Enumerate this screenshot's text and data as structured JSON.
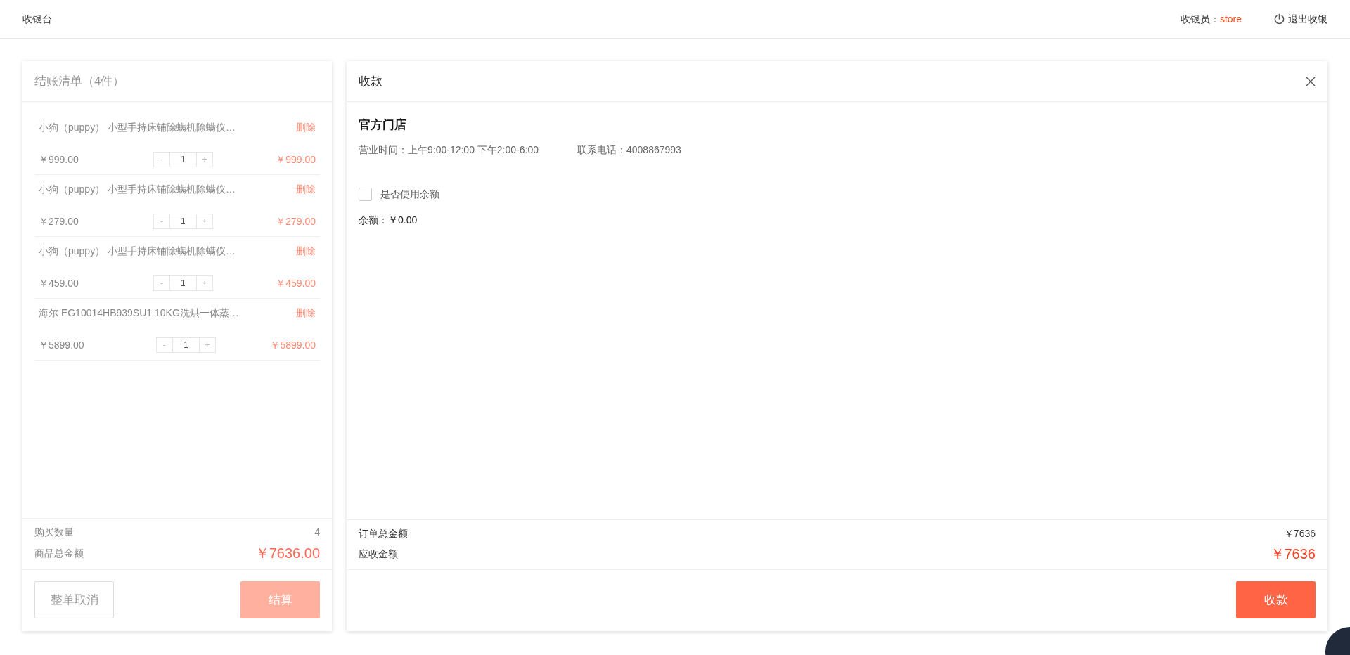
{
  "header": {
    "title": "收银台",
    "cashier_label": "收银员：",
    "cashier_name": "store",
    "logout": "退出收银"
  },
  "cart": {
    "title": "结账清单（4件）",
    "items": [
      {
        "name": "小狗（puppy） 小型手持床铺除螨机除螨仪…",
        "delete": "删除",
        "unit_price": "￥999.00",
        "minus": "-",
        "quantity": "1",
        "plus": "+",
        "subtotal": "￥999.00"
      },
      {
        "name": "小狗（puppy） 小型手持床铺除螨机除螨仪…",
        "delete": "删除",
        "unit_price": "￥279.00",
        "minus": "-",
        "quantity": "1",
        "plus": "+",
        "subtotal": "￥279.00"
      },
      {
        "name": "小狗（puppy） 小型手持床铺除螨机除螨仪…",
        "delete": "删除",
        "unit_price": "￥459.00",
        "minus": "-",
        "quantity": "1",
        "plus": "+",
        "subtotal": "￥459.00"
      },
      {
        "name": "海尔 EG10014HB939SU1 10KG洗烘一体蒸…",
        "delete": "删除",
        "unit_price": "￥5899.00",
        "minus": "-",
        "quantity": "1",
        "plus": "+",
        "subtotal": "￥5899.00"
      }
    ],
    "summary": [
      {
        "kind": "count",
        "label": "购买数量",
        "value": "4"
      },
      {
        "kind": "total",
        "label": "商品总金额",
        "value": "￥7636.00"
      }
    ],
    "cancel_button": "整单取消",
    "checkout_button": {
      "label": "结算",
      "disabled": true
    }
  },
  "payment": {
    "title": "收款",
    "store_name": "官方门店",
    "hours": "营业时间：上午9:00-12:00 下午2:00-6:00",
    "phone": "联系电话：4008867993",
    "use_balance": {
      "label": "是否使用余额",
      "checked": false
    },
    "balance": "余额：￥0.00",
    "totals": [
      {
        "kind": "order",
        "label": "订单总金额",
        "value": "￥7636"
      },
      {
        "kind": "due",
        "label": "应收金额",
        "value": "￥7636"
      }
    ],
    "submit_button": "收款"
  }
}
